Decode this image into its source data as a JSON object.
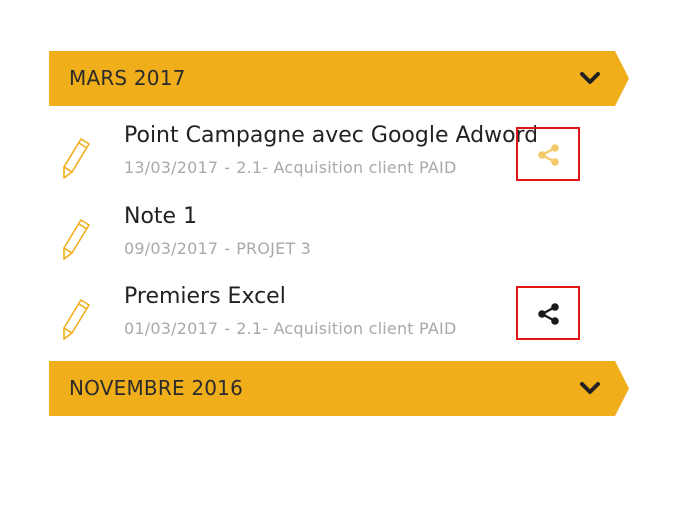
{
  "colors": {
    "accent": "#F0AE1B",
    "pencil": "#F0AE1B",
    "highlight": "#E01414",
    "text_secondary": "#A9A9A9"
  },
  "months": [
    {
      "label": "MARS 2017",
      "icon": "chevron-down-icon",
      "notes": [
        {
          "title": "Point Campagne avec Google Adwords",
          "date": "13/03/2017",
          "separator": "-",
          "project": "2.1- Acquisition client PAID",
          "icon": "pencil-icon",
          "share_icon": "share-icon",
          "share_state": "inactive"
        },
        {
          "title": "Note 1",
          "date": "09/03/2017",
          "separator": "-",
          "project": "PROJET 3",
          "icon": "pencil-icon"
        },
        {
          "title": "Premiers Excel",
          "date": "01/03/2017",
          "separator": "-",
          "project": "2.1- Acquisition client PAID",
          "icon": "pencil-icon",
          "share_icon": "share-icon",
          "share_state": "active"
        }
      ]
    },
    {
      "label": "NOVEMBRE 2016",
      "icon": "chevron-down-icon"
    }
  ]
}
